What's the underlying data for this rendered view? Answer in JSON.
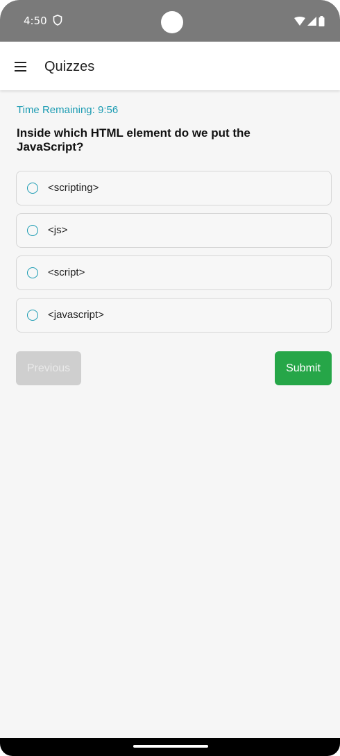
{
  "status_bar": {
    "time": "4:50"
  },
  "app_bar": {
    "title": "Quizzes"
  },
  "quiz": {
    "timer_text": "Time Remaining: 9:56",
    "question": "Inside which HTML element do we put the JavaScript?",
    "options": [
      {
        "label": "<scripting>",
        "selected": false
      },
      {
        "label": "<js>",
        "selected": false
      },
      {
        "label": "<script>",
        "selected": false
      },
      {
        "label": "<javascript>",
        "selected": false
      }
    ],
    "previous_label": "Previous",
    "submit_label": "Submit"
  },
  "colors": {
    "accent": "#1a9bb2",
    "submit": "#26a648",
    "disabled": "#cfcfcf"
  }
}
